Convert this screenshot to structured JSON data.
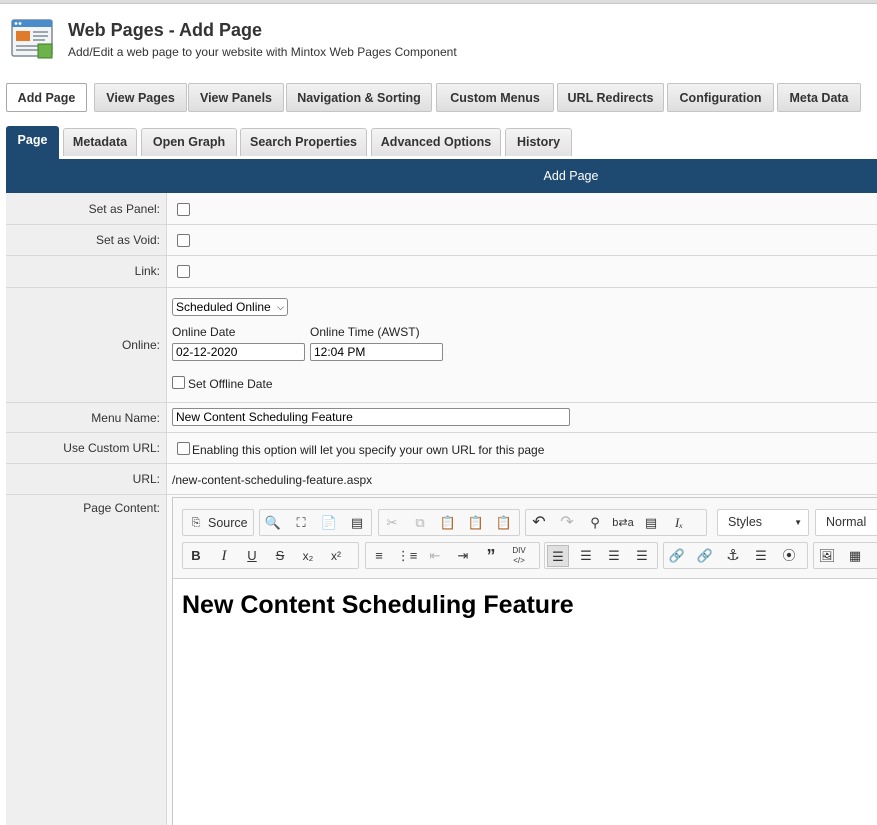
{
  "header": {
    "title": "Web Pages - Add Page",
    "subtitle": "Add/Edit a web page to your website with Mintox Web Pages Component"
  },
  "nav": {
    "buttons": [
      "Add Page",
      "View Pages",
      "View Panels",
      "Navigation & Sorting",
      "Custom Menus",
      "URL Redirects",
      "Configuration",
      "Meta Data"
    ],
    "active": "Add Page"
  },
  "tabs": {
    "items": [
      "Page",
      "Metadata",
      "Open Graph",
      "Search Properties",
      "Advanced Options",
      "History"
    ],
    "active": "Page"
  },
  "section_title": "Add Page",
  "colors": {
    "accent": "#1e4a72"
  },
  "form": {
    "set_as_panel": {
      "label": "Set as Panel:",
      "checked": false
    },
    "set_as_void": {
      "label": "Set as Void:",
      "checked": false
    },
    "link": {
      "label": "Link:",
      "checked": false
    },
    "online": {
      "label": "Online:",
      "select_value": "Scheduled Online",
      "date_label": "Online Date",
      "date_value": "02-12-2020",
      "time_label": "Online Time (AWST)",
      "time_value": "12:04 PM",
      "offline_label": "Set Offline Date",
      "offline_checked": false
    },
    "menu_name": {
      "label": "Menu Name:",
      "value": "New Content Scheduling Feature"
    },
    "custom_url": {
      "label": "Use Custom URL:",
      "text": "Enabling this option will let you specify your own URL for this page",
      "checked": false
    },
    "url": {
      "label": "URL:",
      "value": "/new-content-scheduling-feature.aspx"
    },
    "page_content": {
      "label": "Page Content:"
    }
  },
  "editor": {
    "source_label": "Source",
    "styles_label": "Styles",
    "format_label": "Normal",
    "content_heading": "New Content Scheduling Feature",
    "toolbar_icons": [
      "source-icon",
      "preview-icon",
      "maximize-icon",
      "new-page-icon",
      "templates-icon",
      "cut-icon",
      "copy-icon",
      "paste-icon",
      "paste-text-icon",
      "paste-word-icon",
      "undo-icon",
      "redo-icon",
      "find-icon",
      "replace-icon",
      "select-all-icon",
      "remove-format-icon",
      "bold-icon",
      "italic-icon",
      "underline-icon",
      "strike-icon",
      "subscript-icon",
      "superscript-icon",
      "numbered-list-icon",
      "bulleted-list-icon",
      "outdent-icon",
      "indent-icon",
      "blockquote-icon",
      "div-icon",
      "align-left-icon",
      "align-center-icon",
      "align-right-icon",
      "justify-icon",
      "link-icon",
      "unlink-icon",
      "anchor-icon",
      "layers-icon",
      "rss-icon",
      "image-icon",
      "table-icon"
    ]
  }
}
